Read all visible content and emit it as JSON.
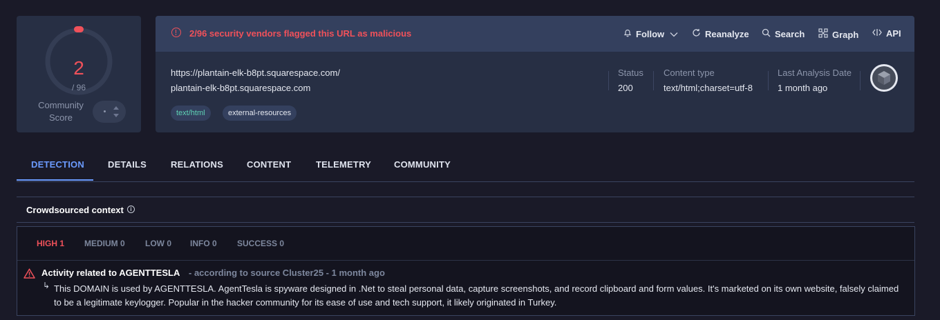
{
  "score": {
    "detected": "2",
    "total": "/ 96",
    "detection_fraction": 0.0208,
    "community_label": "Community Score"
  },
  "alert": {
    "text": "2/96 security vendors flagged this URL as malicious",
    "color": "#f0515a"
  },
  "actions": [
    {
      "label": "Follow",
      "icon": "bell-icon"
    },
    {
      "label": "Reanalyze",
      "icon": "refresh-icon"
    },
    {
      "label": "Search",
      "icon": "search-icon"
    },
    {
      "label": "Graph",
      "icon": "graph-icon"
    },
    {
      "label": "API",
      "icon": "api-icon"
    }
  ],
  "target": {
    "url": "https://plantain-elk-b8pt.squarespace.com/",
    "domain": "plantain-elk-b8pt.squarespace.com",
    "tags": [
      "text/html",
      "external-resources"
    ]
  },
  "meta": [
    {
      "label": "Status",
      "value": "200"
    },
    {
      "label": "Content type",
      "value": "text/html;charset=utf-8"
    },
    {
      "label": "Last Analysis Date",
      "value": "1 month ago"
    }
  ],
  "tabs": [
    "DETECTION",
    "DETAILS",
    "RELATIONS",
    "CONTENT",
    "TELEMETRY",
    "COMMUNITY"
  ],
  "crowdsourced": {
    "title": "Crowdsourced context",
    "filters": [
      "HIGH 1",
      "MEDIUM 0",
      "LOW 0",
      "INFO 0",
      "SUCCESS 0"
    ],
    "entry": {
      "title": "Activity related to AGENTTESLA",
      "source": " - according to source Cluster25 - 1 month ago",
      "arrow": "↳",
      "description": "This DOMAIN is used by AGENTTESLA. AgentTesla is spyware designed in .Net to steal personal data, capture screenshots, and record clipboard and form values. It's marketed on its own website, falsely claimed to be a legitimate keylogger. Popular in the hacker community for its ease of use and tech support, it likely originated in Turkey."
    }
  },
  "colors": {
    "accent": "#6b9bff",
    "danger": "#f0515a",
    "tag_green": "#5fd3b5"
  }
}
